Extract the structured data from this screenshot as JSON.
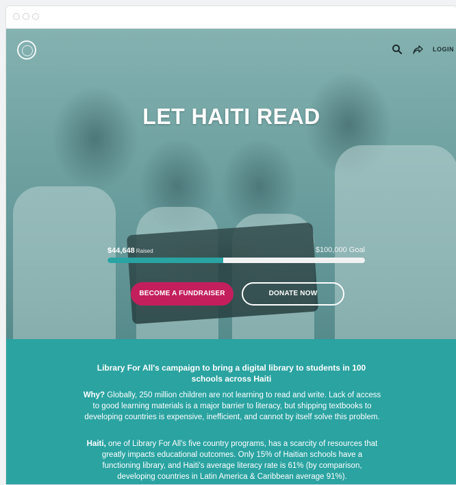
{
  "browser": {
    "window_controls": [
      "close",
      "minimize",
      "maximize"
    ]
  },
  "nav": {
    "login": "LOGIN",
    "icons": [
      "search-icon",
      "share-icon"
    ]
  },
  "hero": {
    "title": "LET HAITI READ",
    "raised_amount": "$44,648",
    "raised_label": "Raised",
    "goal": "$100,000 Goal",
    "progress_fraction": 0.45,
    "fundraiser_button": "BECOME A FUNDRAISER",
    "donate_button": "DONATE NOW"
  },
  "about": {
    "heading": "Library For All's campaign to bring a digital library to students in 100 schools across Haiti",
    "why_lead": "Why?",
    "why_text": " Globally, 250 million children are not learning to read and write. Lack of access to good learning materials is a major barrier to literacy, but shipping textbooks to developing countries is expensive, inefficient, and cannot by itself solve this problem.",
    "haiti_lead": "Haiti,",
    "haiti_text": " one of Library For All's five country programs, has a scarcity of resources that greatly impacts educational outcomes. Only 15% of Haitian schools have a functioning library, and Haiti's average literacy rate is 61% (by comparison, developing countries in Latin America & Caribbean average 91%)."
  },
  "colors": {
    "accent": "#c41f5d",
    "teal": "#2aa3a1",
    "progress": "#2aa3a3"
  }
}
